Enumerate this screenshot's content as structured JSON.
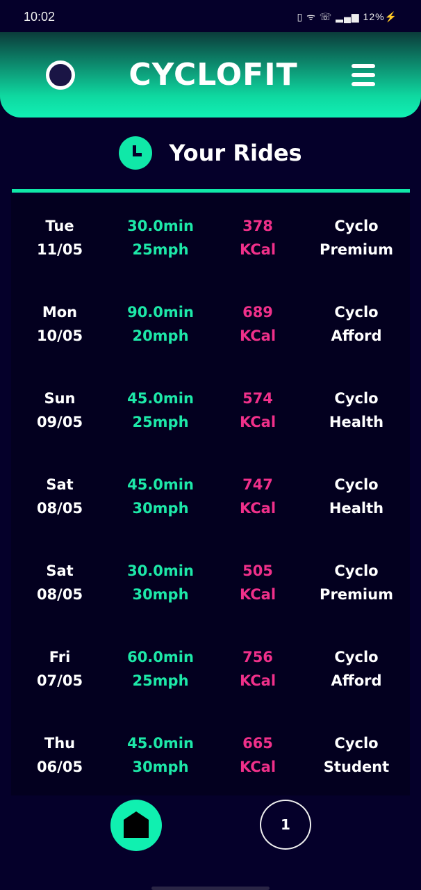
{
  "status": {
    "time": "10:02",
    "battery": "12%"
  },
  "header": {
    "title": "CYCLOFIT"
  },
  "section": {
    "title": "Your Rides"
  },
  "rides": [
    {
      "day": "Tue",
      "date": "11/05",
      "duration": "30.0min",
      "speed": "25mph",
      "kcal": "378",
      "unit": "KCal",
      "plan1": "Cyclo",
      "plan2": "Premium"
    },
    {
      "day": "Mon",
      "date": "10/05",
      "duration": "90.0min",
      "speed": "20mph",
      "kcal": "689",
      "unit": "KCal",
      "plan1": "Cyclo",
      "plan2": "Afford"
    },
    {
      "day": "Sun",
      "date": "09/05",
      "duration": "45.0min",
      "speed": "25mph",
      "kcal": "574",
      "unit": "KCal",
      "plan1": "Cyclo",
      "plan2": "Health"
    },
    {
      "day": "Sat",
      "date": "08/05",
      "duration": "45.0min",
      "speed": "30mph",
      "kcal": "747",
      "unit": "KCal",
      "plan1": "Cyclo",
      "plan2": "Health"
    },
    {
      "day": "Sat",
      "date": "08/05",
      "duration": "30.0min",
      "speed": "30mph",
      "kcal": "505",
      "unit": "KCal",
      "plan1": "Cyclo",
      "plan2": "Premium"
    },
    {
      "day": "Fri",
      "date": "07/05",
      "duration": "60.0min",
      "speed": "25mph",
      "kcal": "756",
      "unit": "KCal",
      "plan1": "Cyclo",
      "plan2": "Afford"
    },
    {
      "day": "Thu",
      "date": "06/05",
      "duration": "45.0min",
      "speed": "30mph",
      "kcal": "665",
      "unit": "KCal",
      "plan1": "Cyclo",
      "plan2": "Student"
    }
  ],
  "nav": {
    "page": "1"
  }
}
